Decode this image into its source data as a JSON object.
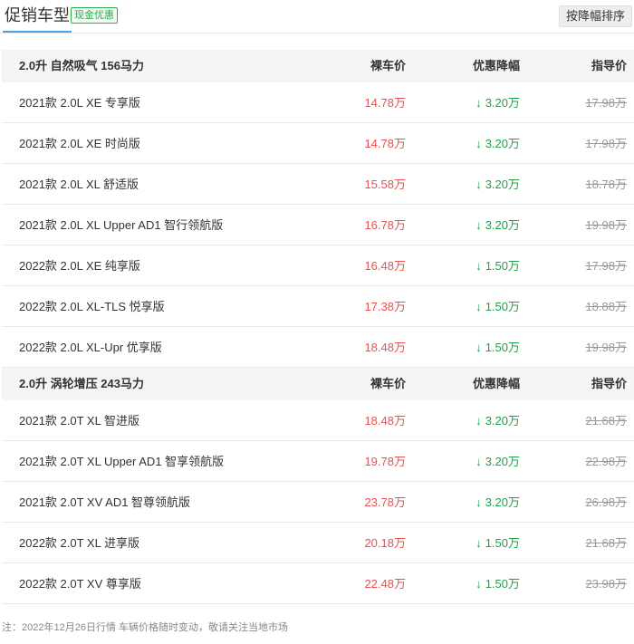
{
  "header": {
    "title": "促销车型",
    "badge": "现金优惠",
    "sort_button": "按降幅排序"
  },
  "columns": {
    "price": "裸车价",
    "discount": "优惠降幅",
    "guide": "指导价"
  },
  "groups": [
    {
      "title": "2.0升 自然吸气 156马力",
      "rows": [
        {
          "name": "2021款 2.0L XE 专享版",
          "price": "14.78万",
          "discount": "3.20万",
          "guide": "17.98万"
        },
        {
          "name": "2021款 2.0L XE 时尚版",
          "price": "14.78万",
          "discount": "3.20万",
          "guide": "17.98万"
        },
        {
          "name": "2021款 2.0L XL 舒适版",
          "price": "15.58万",
          "discount": "3.20万",
          "guide": "18.78万"
        },
        {
          "name": "2021款 2.0L XL Upper AD1 智行领航版",
          "price": "16.78万",
          "discount": "3.20万",
          "guide": "19.98万"
        },
        {
          "name": "2022款 2.0L XE 纯享版",
          "price": "16.48万",
          "discount": "1.50万",
          "guide": "17.98万"
        },
        {
          "name": "2022款 2.0L XL-TLS 悦享版",
          "price": "17.38万",
          "discount": "1.50万",
          "guide": "18.88万"
        },
        {
          "name": "2022款 2.0L XL-Upr 优享版",
          "price": "18.48万",
          "discount": "1.50万",
          "guide": "19.98万"
        }
      ]
    },
    {
      "title": "2.0升 涡轮增压 243马力",
      "rows": [
        {
          "name": "2021款 2.0T XL 智进版",
          "price": "18.48万",
          "discount": "3.20万",
          "guide": "21.68万"
        },
        {
          "name": "2021款 2.0T XL Upper AD1 智享领航版",
          "price": "19.78万",
          "discount": "3.20万",
          "guide": "22.98万"
        },
        {
          "name": "2021款 2.0T XV AD1 智尊领航版",
          "price": "23.78万",
          "discount": "3.20万",
          "guide": "26.98万"
        },
        {
          "name": "2022款 2.0T XL 进享版",
          "price": "20.18万",
          "discount": "1.50万",
          "guide": "21.68万"
        },
        {
          "name": "2022款 2.0T XV 尊享版",
          "price": "22.48万",
          "discount": "1.50万",
          "guide": "23.98万"
        }
      ]
    }
  ],
  "icons": {
    "discount_arrow": "arrow-down-icon"
  },
  "colors": {
    "price": "#e9504f",
    "discount": "#1fa247",
    "guide": "#999999",
    "tab_underline": "#4aa3e6"
  },
  "footnote": "注：2022年12月26日行情 车辆价格随时变动，敬请关注当地市场"
}
